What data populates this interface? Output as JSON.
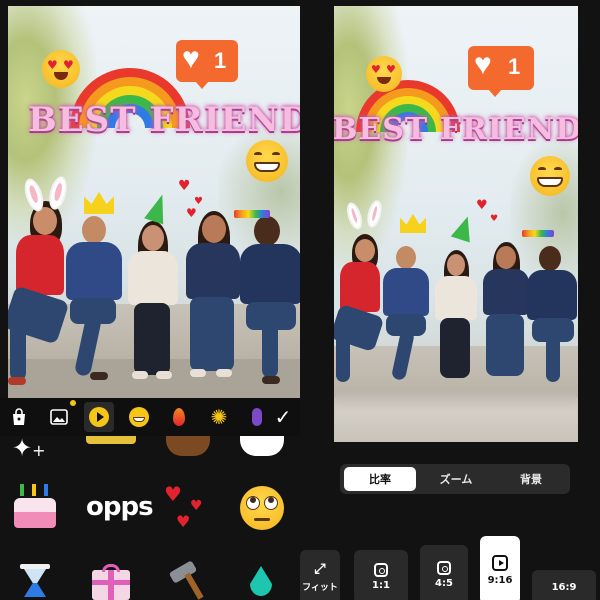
{
  "overlay": {
    "title_text": "BEST FRIENDS",
    "like_count": "1"
  },
  "sticker_toolbar": {
    "items": [
      {
        "icon": "shopping-bag-icon"
      },
      {
        "icon": "image-icon"
      },
      {
        "icon": "play-icon"
      },
      {
        "icon": "grin-emoji-icon"
      },
      {
        "icon": "fire-icon"
      },
      {
        "icon": "fireworks-icon"
      },
      {
        "icon": "purple-sticker-icon"
      },
      {
        "icon": "checkmark-icon"
      }
    ]
  },
  "sticker_grid": {
    "opps_label": "opps"
  },
  "editor": {
    "tabs": [
      {
        "label": "比率",
        "active": true
      },
      {
        "label": "ズーム",
        "active": false
      },
      {
        "label": "背景",
        "active": false
      }
    ],
    "ratio_options": [
      {
        "label": "フィット",
        "icon": "fit-arrows-icon",
        "active": false
      },
      {
        "label": "1:1",
        "icon": "instagram-icon",
        "active": false
      },
      {
        "label": "4:5",
        "icon": "instagram-icon",
        "active": false
      },
      {
        "label": "9:16",
        "icon": "reels-icon",
        "active": true
      },
      {
        "label": "16:9",
        "icon": "",
        "active": false
      }
    ]
  },
  "colors": {
    "accent_yellow": "#f5c518",
    "like_orange": "#f46a2e",
    "pink_text": "#f6bde0"
  }
}
